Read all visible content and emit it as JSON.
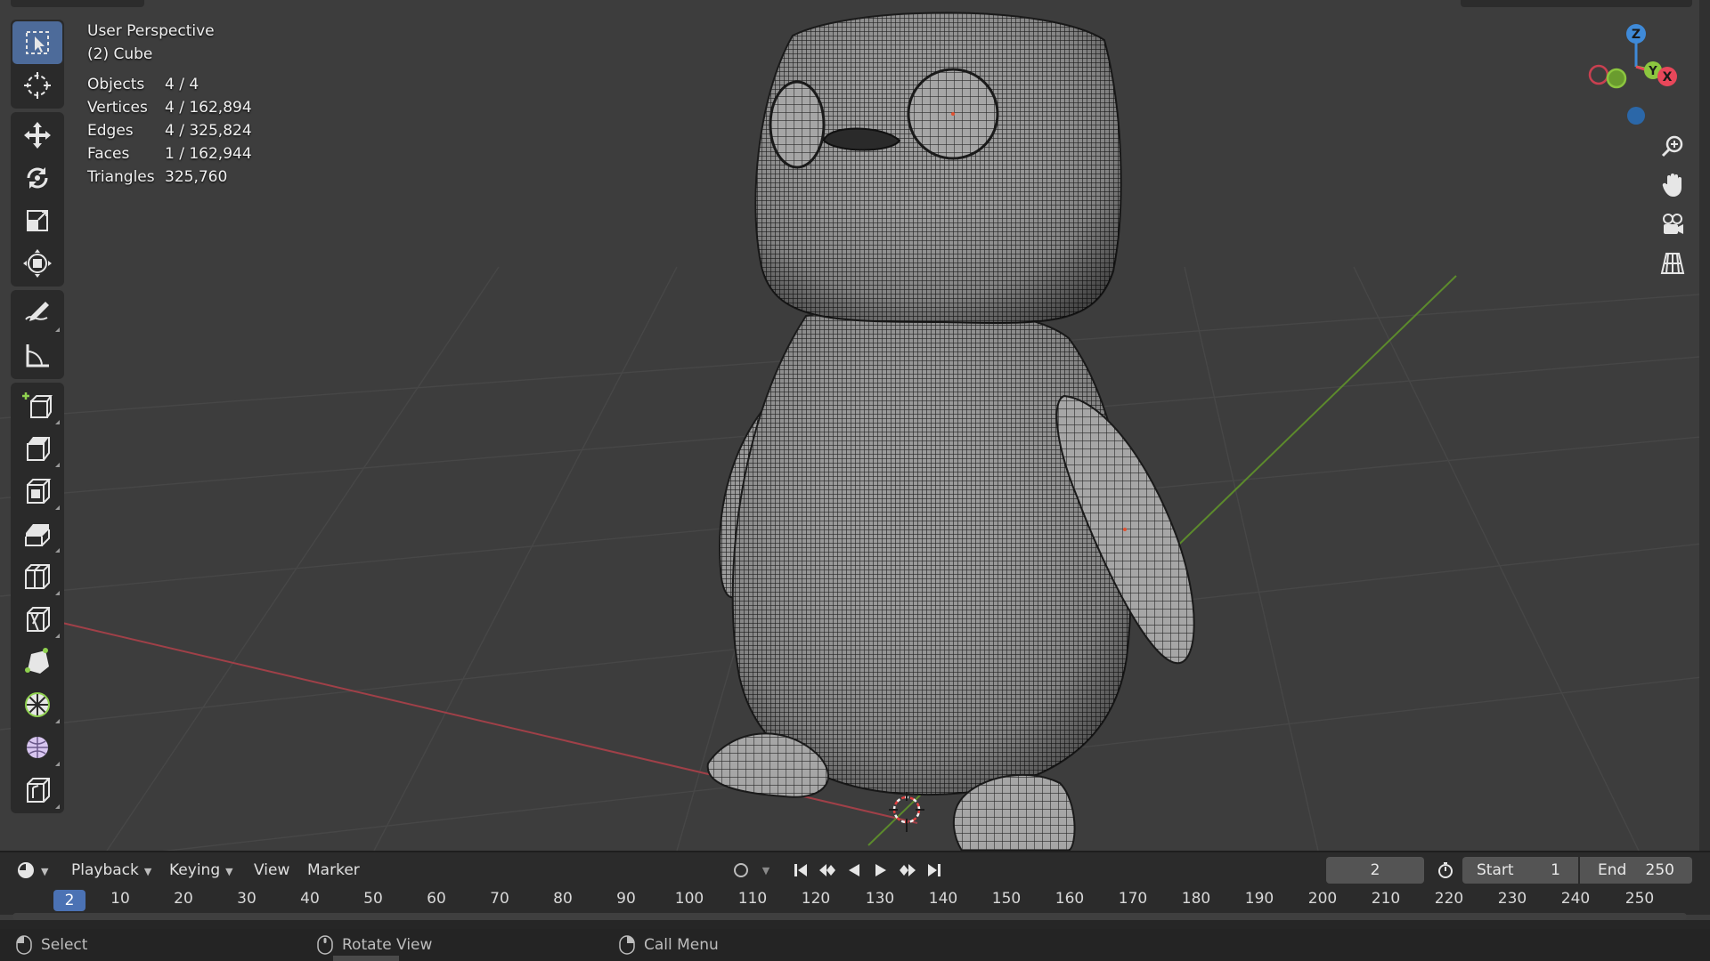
{
  "viewport": {
    "view_name": "User Perspective",
    "object_name": "(2) Cube",
    "stats": [
      {
        "label": "Objects",
        "value": "4 / 4"
      },
      {
        "label": "Vertices",
        "value": "4 / 162,894"
      },
      {
        "label": "Edges",
        "value": "4 / 325,824"
      },
      {
        "label": "Faces",
        "value": "1 / 162,944"
      },
      {
        "label": "Triangles",
        "value": "325,760"
      }
    ],
    "gizmo_axes": {
      "z": "Z",
      "y": "Y",
      "x": "X"
    },
    "colors": {
      "x_axis": "#e8475a",
      "y_axis": "#8cc63f",
      "z_axis": "#3f8ad8",
      "background": "#3d3d3d"
    }
  },
  "toolbar": {
    "icons": [
      "select-box-icon",
      "cursor-icon",
      "move-icon",
      "rotate-icon",
      "scale-icon",
      "transform-icon",
      "annotate-icon",
      "measure-icon",
      "add-cube-icon",
      "extrude-icon",
      "inset-icon",
      "bevel-icon",
      "loop-cut-icon",
      "knife-icon",
      "poly-build-icon",
      "spin-icon",
      "smooth-icon",
      "shear-icon"
    ]
  },
  "nav_buttons": [
    "zoom-icon",
    "pan-hand-icon",
    "camera-icon",
    "grid-view-icon"
  ],
  "timeline": {
    "menus": {
      "playback": "Playback",
      "keying": "Keying",
      "view": "View",
      "marker": "Marker"
    },
    "current_frame": "2",
    "start_label": "Start",
    "start_value": "1",
    "end_label": "End",
    "end_value": "250",
    "ruler_current": "2",
    "ticks": [
      "10",
      "20",
      "30",
      "40",
      "50",
      "60",
      "70",
      "80",
      "90",
      "100",
      "110",
      "120",
      "130",
      "140",
      "150",
      "160",
      "170",
      "180",
      "190",
      "200",
      "210",
      "220",
      "230",
      "240",
      "250"
    ]
  },
  "statusbar": {
    "select": "Select",
    "rotate_view": "Rotate View",
    "call_menu": "Call Menu"
  }
}
